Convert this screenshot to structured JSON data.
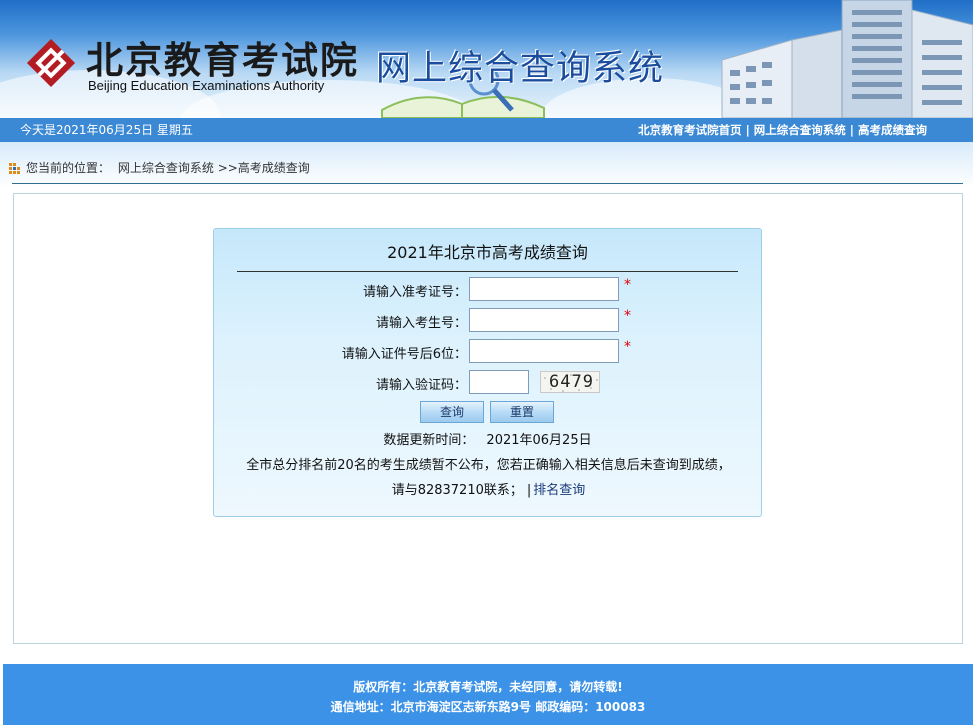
{
  "header": {
    "logo_cn": "北京教育考试院",
    "logo_en": "Beijing Education Examinations Authority",
    "system_title": "网上综合查询系统"
  },
  "topbar": {
    "date_text": "今天是2021年06月25日  星期五",
    "links": [
      "北京教育考试院首页",
      "网上综合查询系统",
      "高考成绩查询"
    ],
    "separator": "|"
  },
  "breadcrumb": {
    "prefix": "您当前的位置：",
    "home": "网上综合查询系统",
    "current": ">>高考成绩查询"
  },
  "form": {
    "title": "2021年北京市高考成绩查询",
    "fields": [
      {
        "label": "请输入准考证号：",
        "value": "",
        "required": true
      },
      {
        "label": "请输入考生号：",
        "value": "",
        "required": true
      },
      {
        "label": "请输入证件号后6位：",
        "value": "",
        "required": true
      },
      {
        "label": "请输入验证码：",
        "value": "",
        "required": false
      }
    ],
    "required_mark": "*",
    "captcha_text": "6479",
    "submit_label": "查询",
    "reset_label": "重置",
    "update_label": "数据更新时间：",
    "update_value": "2021年06月25日",
    "notice": "全市总分排名前20名的考生成绩暂不公布，您若正确输入相关信息后未查询到成绩，请与82837210联系；",
    "notice_bar": "|",
    "rank_link": "排名查询"
  },
  "footer": {
    "copyright": "版权所有：北京教育考试院，未经同意，请勿转载!",
    "address": "通信地址：北京市海淀区志新东路9号 邮政编码：100083"
  },
  "colors": {
    "banner_blue": "#1f6fc8",
    "topbar_blue": "#3b88d4",
    "footer_blue": "#3b92e6",
    "required_red": "#e00000",
    "logo_red": "#b41c24"
  }
}
